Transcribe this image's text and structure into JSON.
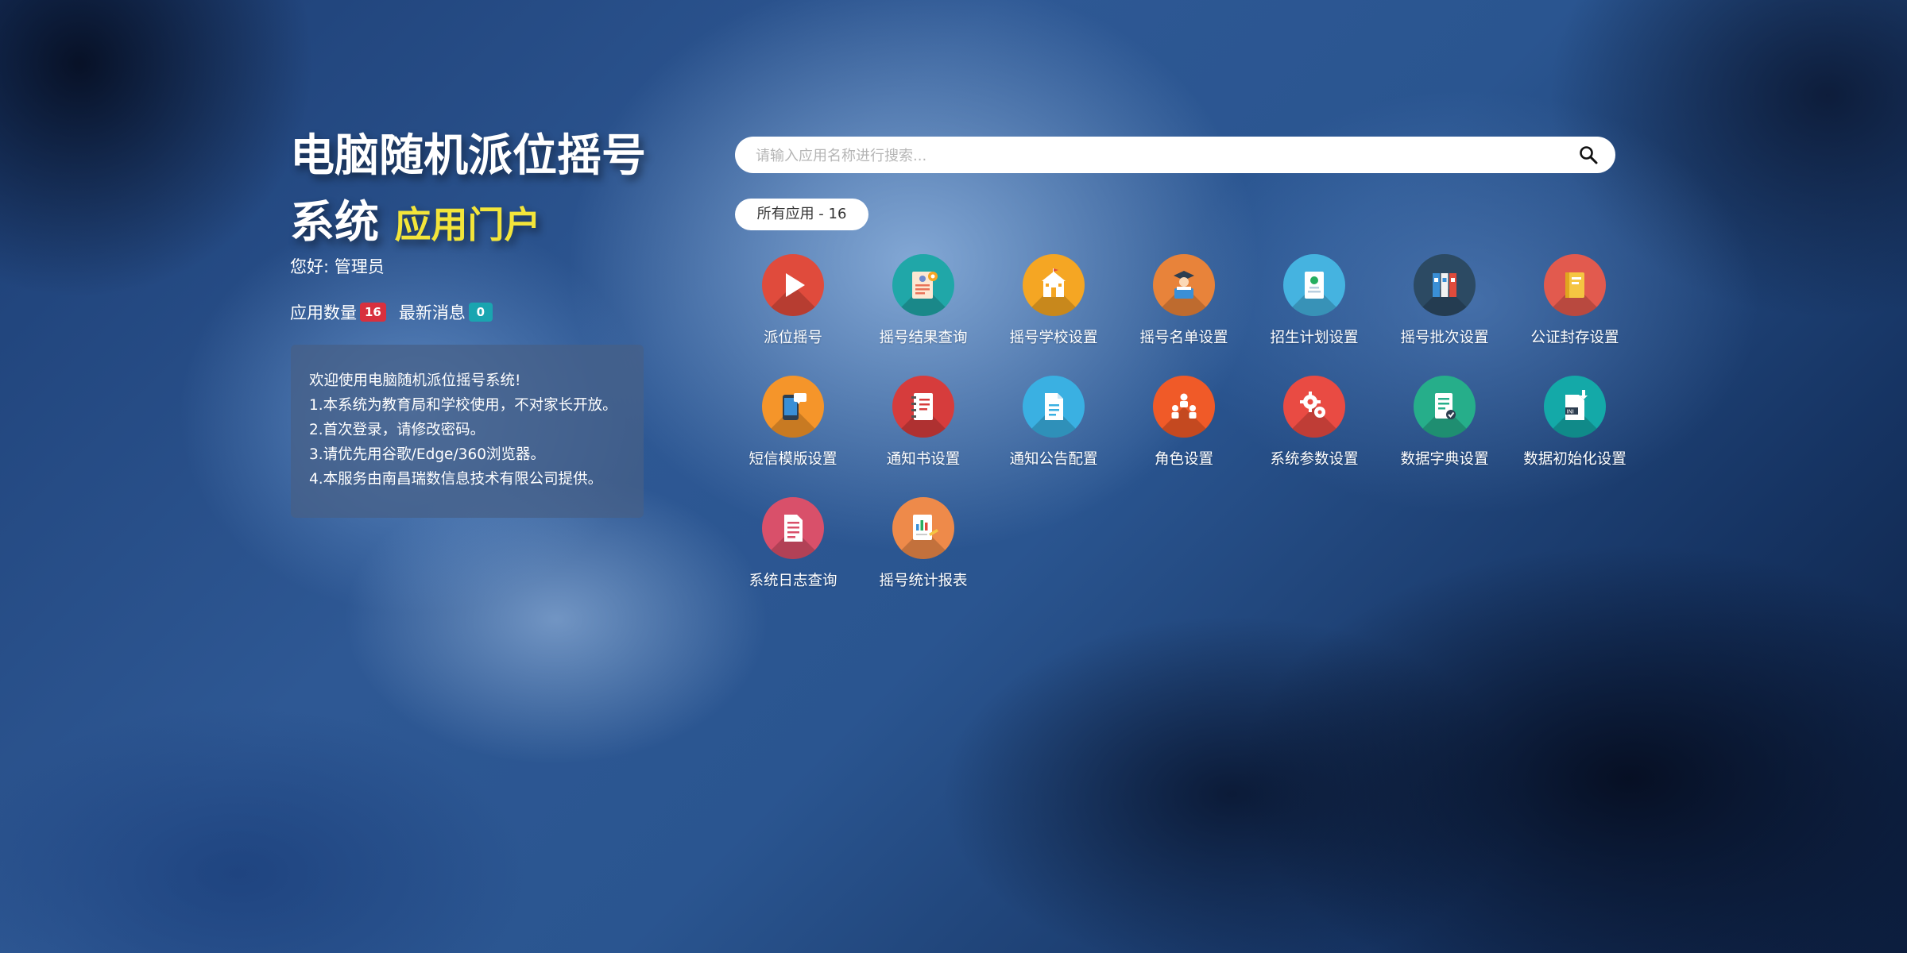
{
  "header": {
    "title_main": "电脑随机派位摇号系统",
    "title_highlight": "应用门户",
    "greeting": "您好: 管理员"
  },
  "stats": {
    "app_count_label": "应用数量",
    "app_count": "16",
    "news_label": "最新消息",
    "news_count": "0"
  },
  "notice": {
    "lines": [
      "欢迎使用电脑随机派位摇号系统!",
      "1.本系统为教育局和学校使用，不对家长开放。",
      "2.首次登录，请修改密码。",
      "3.请优先用谷歌/Edge/360浏览器。",
      "4.本服务由南昌瑞数信息技术有限公司提供。"
    ]
  },
  "search": {
    "placeholder": "请输入应用名称进行搜索...",
    "value": ""
  },
  "filter": {
    "label": "所有应用 - 16"
  },
  "apps": [
    {
      "label": "派位摇号",
      "icon": "play-icon",
      "color": "#e04b3c"
    },
    {
      "label": "摇号结果查询",
      "icon": "certificate-icon",
      "color": "#20a7a8"
    },
    {
      "label": "摇号学校设置",
      "icon": "school-icon",
      "color": "#f5a623"
    },
    {
      "label": "摇号名单设置",
      "icon": "graduate-icon",
      "color": "#e8833a"
    },
    {
      "label": "招生计划设置",
      "icon": "id-card-icon",
      "color": "#45b3e0"
    },
    {
      "label": "摇号批次设置",
      "icon": "binders-icon",
      "color": "#2c4a63"
    },
    {
      "label": "公证封存设置",
      "icon": "book-icon",
      "color": "#e25a4e"
    },
    {
      "label": "短信模版设置",
      "icon": "sms-phone-icon",
      "color": "#f5952a"
    },
    {
      "label": "通知书设置",
      "icon": "notebook-icon",
      "color": "#d63c3c"
    },
    {
      "label": "通知公告配置",
      "icon": "document-icon",
      "color": "#3ab0e2"
    },
    {
      "label": "角色设置",
      "icon": "people-icon",
      "color": "#f05a28"
    },
    {
      "label": "系统参数设置",
      "icon": "gears-icon",
      "color": "#e94b43"
    },
    {
      "label": "数据字典设置",
      "icon": "checked-document-icon",
      "color": "#26ae8a"
    },
    {
      "label": "数据初始化设置",
      "icon": "ini-file-icon",
      "color": "#14a9a8"
    },
    {
      "label": "系统日志查询",
      "icon": "log-document-icon",
      "color": "#d9506a"
    },
    {
      "label": "摇号统计报表",
      "icon": "report-chart-icon",
      "color": "#ee8a4a"
    }
  ]
}
